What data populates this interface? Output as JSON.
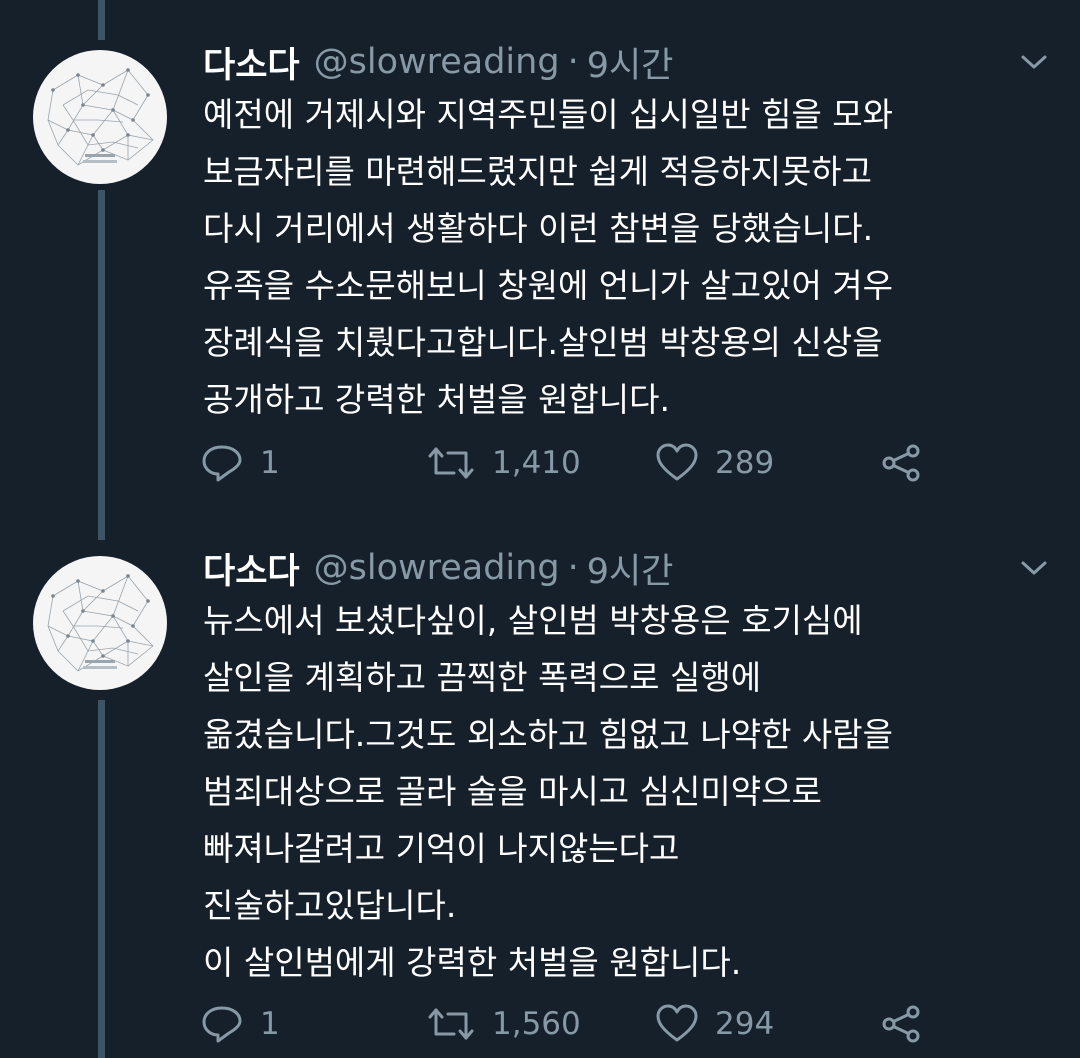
{
  "colors": {
    "background": "#15202b",
    "secondary_text": "#8899a6",
    "thread_line": "#3d5466"
  },
  "tweets": [
    {
      "name": "다소다",
      "handle": "@slowreading",
      "separator": "·",
      "time": "9시간",
      "text": "예전에 거제시와 지역주민들이 십시일반 힘을 모와\n보금자리를 마련해드렸지만 쉽게 적응하지못하고\n다시 거리에서 생활하다 이런 참변을 당했습니다.\n유족을 수소문해보니 창원에 언니가 살고있어 겨우\n장례식을 치뤘다고합니다.살인범 박창용의 신상을\n공개하고 강력한 처벌을 원합니다.",
      "reply_count": "1",
      "retweet_count": "1,410",
      "like_count": "289",
      "icons": {
        "reply": "reply-icon",
        "retweet": "retweet-icon",
        "like": "heart-icon",
        "share": "share-icon",
        "more": "chevron-down-icon"
      }
    },
    {
      "name": "다소다",
      "handle": "@slowreading",
      "separator": "·",
      "time": "9시간",
      "text": "뉴스에서 보셨다싶이, 살인범 박창용은 호기심에\n살인을 계획하고 끔찍한 폭력으로 실행에\n옮겼습니다.그것도 외소하고 힘없고 나약한 사람을\n범죄대상으로 골라 술을 마시고 심신미약으로\n빠져나갈려고 기억이 나지않는다고\n진술하고있답니다.\n이 살인범에게 강력한 처벌을 원합니다.",
      "reply_count": "1",
      "retweet_count": "1,560",
      "like_count": "294",
      "icons": {
        "reply": "reply-icon",
        "retweet": "retweet-icon",
        "like": "heart-icon",
        "share": "share-icon",
        "more": "chevron-down-icon"
      }
    }
  ]
}
